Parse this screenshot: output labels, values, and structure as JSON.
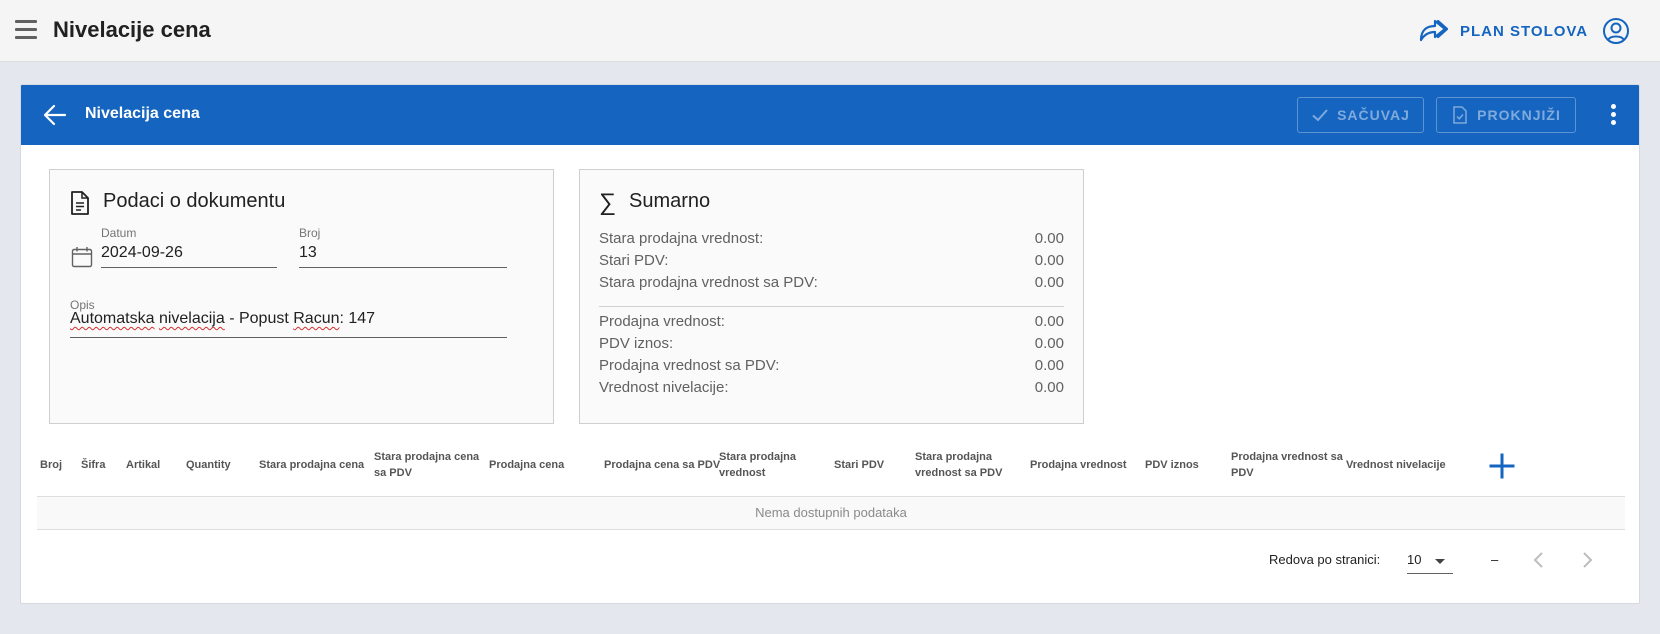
{
  "appbar": {
    "title": "Nivelacije cena",
    "plan_label": "PLAN STOLOVA",
    "icons": {
      "menu": "menu-icon",
      "plan": "share-arrow-icon",
      "account": "account-circle-icon"
    }
  },
  "card": {
    "title": "Nivelacija cena",
    "save_label": "SAČUVAJ",
    "post_label": "PROKNJIŽI",
    "accent_color": "#1565c0"
  },
  "document": {
    "title": "Podaci o dokumentu",
    "date_label": "Datum",
    "date_value": "2024-09-26",
    "number_label": "Broj",
    "number_value": "13",
    "desc_label": "Opis",
    "desc_word1": "Automatska",
    "desc_word2": "nivelacija",
    "desc_sep": " - ",
    "desc_word3": "Popust",
    "desc_word4": "Racun",
    "desc_tail": ": 147"
  },
  "summary": {
    "title": "Sumarno",
    "rows_old": [
      {
        "label": "Stara prodajna vrednost:",
        "value": "0.00"
      },
      {
        "label": "Stari PDV:",
        "value": "0.00"
      },
      {
        "label": "Stara prodajna vrednost sa PDV:",
        "value": "0.00"
      }
    ],
    "rows_new": [
      {
        "label": "Prodajna vrednost:",
        "value": "0.00"
      },
      {
        "label": "PDV iznos:",
        "value": "0.00"
      },
      {
        "label": "Prodajna vrednost sa PDV:",
        "value": "0.00"
      },
      {
        "label": "Vrednost nivelacije:",
        "value": "0.00"
      }
    ]
  },
  "table": {
    "columns": [
      {
        "l1": "Broj",
        "l2": ""
      },
      {
        "l1": "Šifra",
        "l2": ""
      },
      {
        "l1": "Artikal",
        "l2": ""
      },
      {
        "l1": "Quantity",
        "l2": ""
      },
      {
        "l1": "Stara prodajna cena",
        "l2": ""
      },
      {
        "l1": "Stara prodajna cena",
        "l2": "sa PDV"
      },
      {
        "l1": "Prodajna cena",
        "l2": ""
      },
      {
        "l1": "Prodajna cena sa PDV",
        "l2": ""
      },
      {
        "l1": "Stara prodajna",
        "l2": "vrednost"
      },
      {
        "l1": "Stari PDV",
        "l2": ""
      },
      {
        "l1": "Stara prodajna",
        "l2": "vrednost sa PDV"
      },
      {
        "l1": "Prodajna vrednost",
        "l2": ""
      },
      {
        "l1": "PDV iznos",
        "l2": ""
      },
      {
        "l1": "Prodajna vrednost sa",
        "l2": "PDV"
      },
      {
        "l1": "Vrednost nivelacije",
        "l2": ""
      }
    ],
    "empty_text": "Nema dostupnih podataka"
  },
  "pagination": {
    "rows_label": "Redova po stranici:",
    "rows_value": "10",
    "range_text": "–"
  }
}
